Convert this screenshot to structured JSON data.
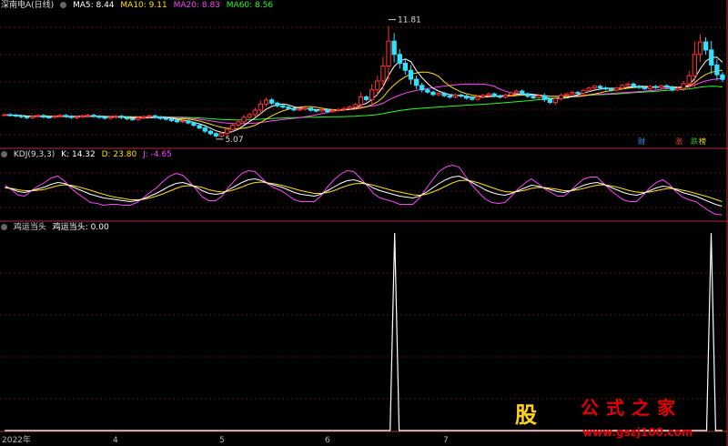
{
  "header1": {
    "title": "深南电A(日线)",
    "ma": [
      {
        "label": "MA5: 8.44",
        "color": "#ffffff"
      },
      {
        "label": "MA10: 9.11",
        "color": "#ffe000"
      },
      {
        "label": "MA20: 8.83",
        "color": "#ff44ff"
      },
      {
        "label": "MA60: 8.56",
        "color": "#22ff22"
      }
    ]
  },
  "header2": {
    "title": "KDJ(9,3,3)",
    "k": {
      "label": "K: 14.32",
      "color": "#ffffff"
    },
    "d": {
      "label": "D: 23.80",
      "color": "#ffe000"
    },
    "j": {
      "label": "J: -4.65",
      "color": "#ff44ff"
    }
  },
  "header3": {
    "title": "鸡运当头",
    "value": {
      "label": "鸡运当头: 0.00",
      "color": "#ffffff"
    }
  },
  "badges": [
    {
      "text": "财",
      "color": "#3a9bff"
    },
    {
      "text": "涨",
      "color": "#ff4444"
    },
    {
      "text": "跌",
      "color": "#22cc22"
    },
    {
      "text": "榜",
      "color": "#ffe000"
    }
  ],
  "x_axis": [
    "2022年",
    "4",
    "5",
    "6",
    "7"
  ],
  "watermark": {
    "logo": "股",
    "title": "公式之家",
    "url": "www.gszj100.com"
  },
  "chart_data": [
    {
      "type": "candlestick",
      "title": "深南电A(日线)",
      "annotations": [
        {
          "text": "11.81",
          "kind": "high"
        },
        {
          "text": "5.07",
          "kind": "low"
        }
      ],
      "ylim": [
        4.6,
        12.2
      ],
      "close": [
        6.45,
        6.42,
        6.38,
        6.33,
        6.28,
        6.35,
        6.4,
        6.32,
        6.3,
        6.36,
        6.41,
        6.34,
        6.29,
        6.33,
        6.38,
        6.42,
        6.35,
        6.3,
        6.25,
        6.31,
        6.36,
        6.29,
        6.22,
        6.18,
        6.27,
        6.33,
        6.38,
        6.3,
        6.24,
        6.2,
        6.12,
        6.05,
        6.1,
        5.98,
        5.85,
        5.7,
        5.52,
        5.38,
        5.25,
        5.4,
        5.62,
        5.85,
        6.05,
        6.3,
        6.45,
        6.7,
        7.05,
        7.28,
        7.1,
        6.95,
        6.88,
        6.8,
        6.72,
        6.76,
        6.82,
        6.7,
        6.66,
        6.73,
        6.62,
        6.68,
        6.74,
        6.8,
        6.88,
        7.02,
        7.45,
        7.3,
        7.85,
        8.35,
        9.2,
        10.6,
        9.85,
        9.35,
        8.95,
        8.45,
        8.1,
        7.85,
        7.72,
        7.58,
        7.66,
        7.52,
        7.44,
        7.56,
        7.5,
        7.38,
        7.32,
        7.46,
        7.54,
        7.62,
        7.5,
        7.44,
        7.56,
        7.68,
        7.78,
        7.62,
        7.48,
        7.4,
        7.52,
        7.3,
        7.14,
        7.36,
        7.55,
        7.62,
        7.7,
        7.66,
        7.82,
        7.95,
        8.05,
        7.96,
        7.9,
        7.84,
        7.95,
        8.1,
        8.18,
        8.05,
        7.98,
        7.92,
        8.04,
        7.98,
        8.08,
        8.0,
        7.85,
        7.94,
        8.2,
        8.65,
        9.85,
        10.55,
        10.1,
        9.25,
        8.7,
        8.44
      ],
      "ma5": 8.44,
      "ma10": 9.11,
      "ma20": 8.83,
      "ma60": 8.56
    },
    {
      "type": "line",
      "title": "KDJ(9,3,3)",
      "ylim": [
        -15,
        115
      ],
      "series": [
        {
          "name": "K",
          "values": [
            56,
            52,
            46,
            44,
            48,
            52,
            56,
            62,
            66,
            64,
            58,
            52,
            46,
            40,
            36,
            32,
            30,
            28,
            26,
            24,
            26,
            30,
            36,
            42,
            50,
            58,
            64,
            66,
            62,
            56,
            48,
            42,
            40,
            42,
            50,
            58,
            66,
            72,
            74,
            70,
            64,
            60,
            56,
            50,
            44,
            40,
            38,
            36,
            40,
            48,
            56,
            64,
            70,
            72,
            68,
            62,
            54,
            48,
            44,
            40,
            36,
            34,
            32,
            36,
            44,
            54,
            64,
            72,
            78,
            80,
            74,
            66,
            58,
            50,
            44,
            40,
            38,
            42,
            48,
            54,
            60,
            58,
            54,
            50,
            46,
            44,
            48,
            54,
            60,
            64,
            66,
            62,
            56,
            50,
            44,
            40,
            38,
            42,
            48,
            54,
            58,
            56,
            50,
            44,
            40,
            36,
            30,
            24,
            18,
            14
          ]
        },
        {
          "name": "D",
          "values": [
            54,
            53,
            50,
            48,
            48,
            49,
            51,
            55,
            59,
            61,
            60,
            57,
            53,
            49,
            44,
            40,
            36,
            33,
            31,
            28,
            28,
            29,
            32,
            36,
            41,
            47,
            53,
            58,
            59,
            58,
            55,
            50,
            47,
            45,
            47,
            51,
            56,
            62,
            66,
            67,
            65,
            63,
            60,
            56,
            52,
            48,
            45,
            42,
            42,
            44,
            48,
            54,
            59,
            63,
            64,
            63,
            60,
            56,
            52,
            48,
            45,
            42,
            39,
            38,
            40,
            45,
            51,
            58,
            65,
            70,
            71,
            69,
            65,
            60,
            55,
            50,
            46,
            45,
            46,
            49,
            53,
            55,
            55,
            53,
            51,
            48,
            48,
            50,
            53,
            57,
            60,
            61,
            59,
            56,
            52,
            48,
            45,
            44,
            45,
            48,
            51,
            53,
            52,
            49,
            46,
            42,
            38,
            34,
            29,
            24
          ]
        },
        {
          "name": "J",
          "values": [
            60,
            50,
            38,
            36,
            48,
            58,
            66,
            76,
            80,
            70,
            54,
            42,
            32,
            22,
            20,
            16,
            18,
            18,
            16,
            16,
            22,
            32,
            44,
            54,
            68,
            80,
            86,
            82,
            68,
            52,
            34,
            26,
            26,
            36,
            56,
            72,
            86,
            92,
            90,
            76,
            62,
            54,
            48,
            38,
            28,
            24,
            24,
            24,
            36,
            56,
            72,
            84,
            92,
            90,
            76,
            60,
            42,
            32,
            28,
            24,
            18,
            18,
            18,
            32,
            52,
            72,
            90,
            100,
            104,
            100,
            80,
            60,
            44,
            30,
            22,
            20,
            22,
            36,
            52,
            64,
            74,
            64,
            52,
            44,
            36,
            36,
            48,
            62,
            74,
            78,
            78,
            64,
            50,
            38,
            28,
            24,
            24,
            38,
            54,
            66,
            72,
            62,
            46,
            34,
            28,
            24,
            14,
            4,
            -4,
            -5
          ]
        }
      ]
    },
    {
      "type": "line",
      "title": "鸡运当头",
      "ylim": [
        0,
        1
      ],
      "series": [
        {
          "name": "鸡运当头",
          "values": [
            0,
            0,
            0,
            0,
            0,
            0,
            0,
            0,
            0,
            0,
            0,
            0,
            0,
            0,
            0,
            0,
            0,
            0,
            0,
            0,
            0,
            0,
            0,
            0,
            0,
            0,
            0,
            0,
            0,
            0,
            0,
            0,
            0,
            0,
            0,
            0,
            0,
            0,
            0,
            0,
            0,
            0,
            0,
            0,
            0,
            0,
            0,
            0,
            0,
            0,
            0,
            0,
            0,
            0,
            0,
            0,
            0,
            0,
            0,
            0,
            0,
            0,
            0,
            0,
            0,
            0,
            0,
            0,
            0,
            1,
            0,
            0,
            0,
            0,
            0,
            0,
            0,
            0,
            0,
            0,
            0,
            0,
            0,
            0,
            0,
            0,
            0,
            0,
            0,
            0,
            0,
            0,
            0,
            0,
            0,
            0,
            0,
            0,
            0,
            0,
            0,
            0,
            0,
            0,
            0,
            0,
            0,
            0,
            0,
            0,
            0,
            0,
            0,
            0,
            0,
            0,
            0,
            0,
            0,
            0,
            0,
            0,
            0,
            0,
            0,
            1,
            0,
            0
          ]
        }
      ]
    }
  ]
}
